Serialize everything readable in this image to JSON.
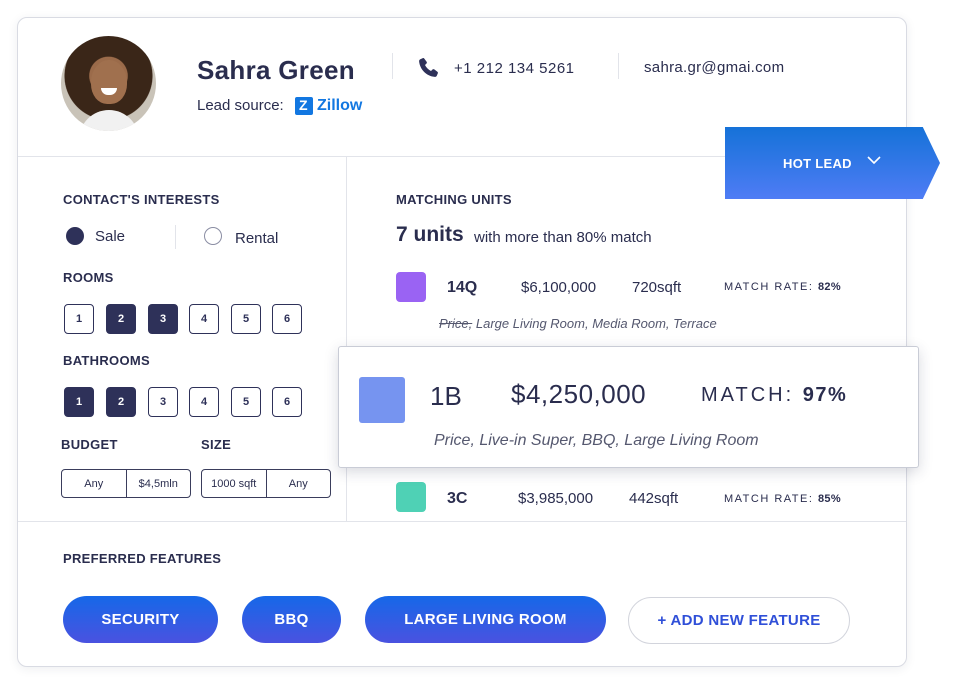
{
  "contact": {
    "name": "Sahra Green",
    "lead_source_label": "Lead source:",
    "lead_source": "Zillow",
    "phone": "+1 212 134 5261",
    "email": "sahra.gr@gmai.com"
  },
  "status": {
    "label": "HOT LEAD",
    "icon": "chevron-down-icon"
  },
  "interests": {
    "title": "CONTACT'S INTERESTS",
    "options": [
      {
        "label": "Sale",
        "selected": true
      },
      {
        "label": "Rental",
        "selected": false
      }
    ],
    "rooms": {
      "title": "ROOMS",
      "options": [
        "1",
        "2",
        "3",
        "4",
        "5",
        "6"
      ],
      "selected": [
        "2",
        "3"
      ]
    },
    "bathrooms": {
      "title": "BATHROOMS",
      "options": [
        "1",
        "2",
        "3",
        "4",
        "5",
        "6"
      ],
      "selected": [
        "1",
        "2"
      ]
    },
    "budget": {
      "title": "BUDGET",
      "min": "Any",
      "max": "$4,5mln"
    },
    "size": {
      "title": "SIZE",
      "min": "1000 sqft",
      "max": "Any"
    }
  },
  "matching": {
    "title": "MATCHING UNITS",
    "count": "7 units",
    "count_desc": "with more than 80% match",
    "units": [
      {
        "id": "14Q",
        "price": "$6,100,000",
        "size": "720sqft",
        "match_label": "MATCH RATE:",
        "match": "82%",
        "color": "#9a63f3",
        "features_struck": "Price,",
        "features": "Large Living Room, Media Room, Terrace"
      },
      {
        "id": "3C",
        "price": "$3,985,000",
        "size": "442sqft",
        "match_label": "MATCH RATE:",
        "match": "85%",
        "color": "#4fd1b5"
      }
    ],
    "highlighted": {
      "id": "1B",
      "price": "$4,250,000",
      "match_label": "MATCH:",
      "match": "97%",
      "color": "#7694f0",
      "features": "Price, Live-in Super, BBQ, Large Living Room"
    }
  },
  "preferred": {
    "title": "PREFERRED FEATURES",
    "features": [
      "SECURITY",
      "BBQ",
      "LARGE LIVING ROOM"
    ],
    "add_label": "+ ADD NEW FEATURE"
  },
  "colors": {
    "accent": "#1668e8",
    "navy": "#2e3159",
    "hot_lead_top": "#1572d8",
    "hot_lead_bottom": "#4f7cf5"
  }
}
